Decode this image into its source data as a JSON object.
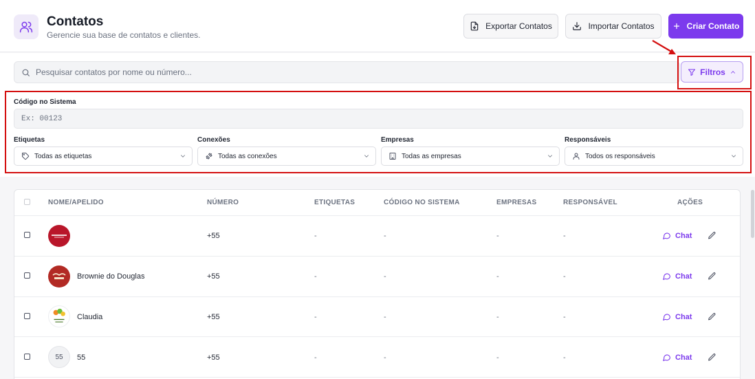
{
  "header": {
    "title": "Contatos",
    "subtitle": "Gerencie sua base de contatos e clientes.",
    "export_label": "Exportar Contatos",
    "import_label": "Importar Contatos",
    "create_label": "Criar Contato"
  },
  "search": {
    "placeholder": "Pesquisar contatos por nome ou número...",
    "value": ""
  },
  "filters_button": {
    "label": "Filtros"
  },
  "filters": {
    "code_label": "Código no Sistema",
    "code_placeholder": "Ex: 00123",
    "tags_label": "Etiquetas",
    "tags_value": "Todas as etiquetas",
    "connections_label": "Conexões",
    "connections_value": "Todas as conexões",
    "companies_label": "Empresas",
    "companies_value": "Todas as empresas",
    "responsibles_label": "Responsáveis",
    "responsibles_value": "Todos os responsáveis"
  },
  "table": {
    "columns": [
      "NOME/APELIDO",
      "NÚMERO",
      "ETIQUETAS",
      "CÓDIGO NO SISTEMA",
      "EMPRESAS",
      "RESPONSÁVEL",
      "AÇÕES"
    ],
    "chat_label": "Chat",
    "rows": [
      {
        "name": "",
        "number": "+55",
        "tags": "-",
        "code": "-",
        "companies": "-",
        "responsible": "-",
        "avatar_text": ""
      },
      {
        "name": "Brownie do Douglas",
        "number": "+55",
        "tags": "-",
        "code": "-",
        "companies": "-",
        "responsible": "-",
        "avatar_text": ""
      },
      {
        "name": "Claudia",
        "number": "+55",
        "tags": "-",
        "code": "-",
        "companies": "-",
        "responsible": "-",
        "avatar_text": ""
      },
      {
        "name": "55",
        "number": "+55",
        "tags": "-",
        "code": "-",
        "companies": "-",
        "responsible": "-",
        "avatar_text": "55"
      }
    ]
  },
  "colors": {
    "accent": "#7c3aed",
    "highlight": "#d40f0f"
  }
}
